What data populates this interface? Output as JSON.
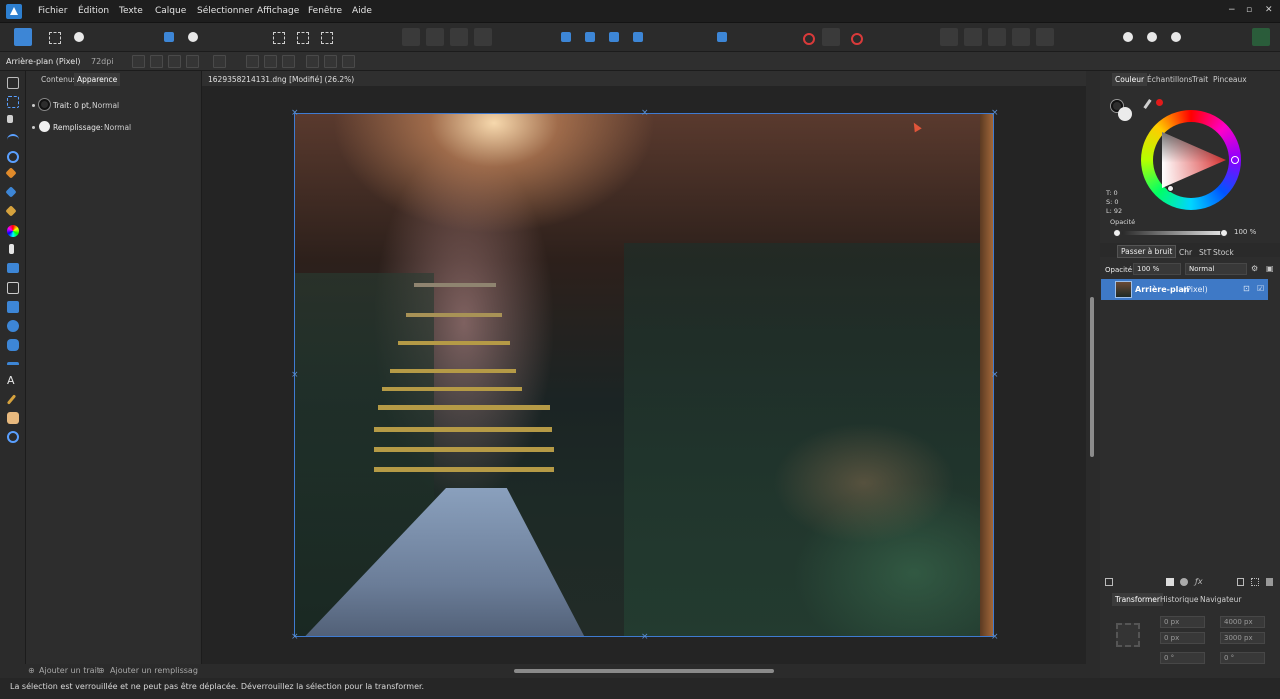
{
  "app": {
    "menu": [
      "Fichier",
      "Édition",
      "Texte",
      "Calque",
      "Sélectionner",
      "Affichage",
      "Fenêtre",
      "Aide"
    ],
    "window_controls": [
      "−",
      "▫",
      "✕"
    ]
  },
  "context_toolbar": {
    "layer_name": "Arrière-plan (Pixel)",
    "dpi": "72dpi"
  },
  "left_panel": {
    "tabs": [
      "Contenus",
      "Apparence"
    ],
    "active_tab": "Apparence",
    "stroke_label": "Trait: 0 pt,",
    "stroke_mode": "Normal",
    "fill_label": "Remplissage:",
    "fill_mode": "Normal",
    "add_stroke": "Ajouter un trait",
    "add_fill": "Ajouter un remplissag"
  },
  "document": {
    "tab_title": "1629358214131.dng [Modifié] (26.2%)"
  },
  "color_panel": {
    "tabs": [
      "Couleur",
      "Échantillons",
      "Trait",
      "Pinceaux"
    ],
    "active_tab": "Couleur",
    "t_value": "T: 0",
    "s_value": "S: 0",
    "l_value": "L: 92",
    "opacity_label": "Opacité",
    "opacity_value": "100 %",
    "accent": "#d83030"
  },
  "layers_panel": {
    "tooltip": "Passer à bruit",
    "tabs": [
      "Chr",
      "StT",
      "Stock"
    ],
    "opacity_label": "Opacité:",
    "opacity_value": "100 %",
    "blend_mode": "Normal",
    "layer_name": "Arrière-plan",
    "layer_type": "(Pixel)",
    "selected_color": "#3e79c6"
  },
  "transform_panel": {
    "tabs": [
      "Transformer",
      "Historique",
      "Navigateur"
    ],
    "active_tab": "Transformer",
    "x": "0 px",
    "y": "0 px",
    "w": "4000 px",
    "h": "3000 px",
    "r": "0 °",
    "s": "0 °"
  },
  "status": {
    "message": "La sélection est verrouillée et ne peut pas être déplacée. Déverrouillez la sélection pour la transformer."
  }
}
